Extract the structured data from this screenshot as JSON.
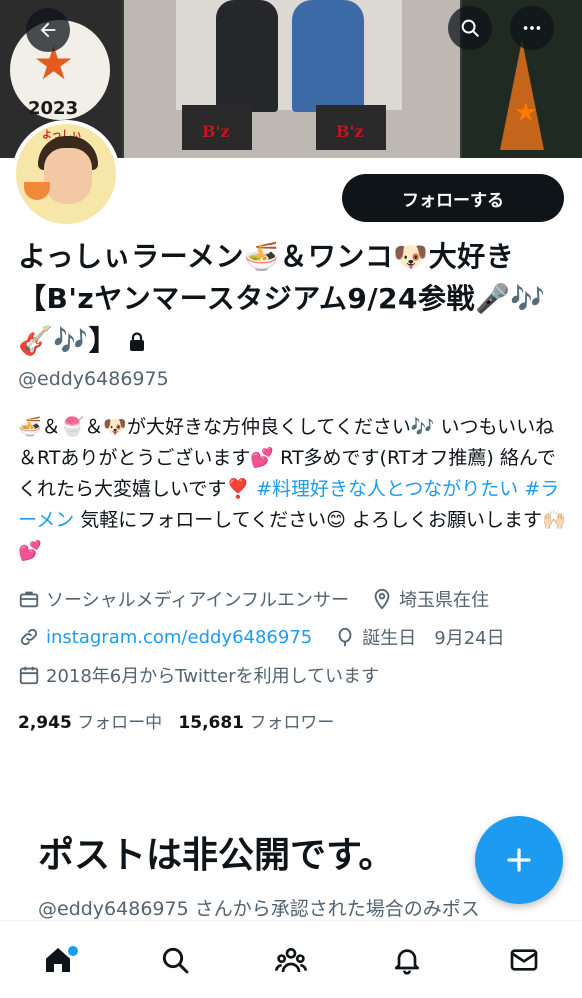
{
  "header": {
    "back_icon": "arrow-left-icon",
    "search_icon": "search-icon",
    "more_icon": "more-icon",
    "banner_year": "2023",
    "banner_bz_text": "B'z",
    "avatar_text": "よっしぃ"
  },
  "profile": {
    "follow_label": "フォローする",
    "display_name": "よっしぃラーメン🍜＆ワンコ🐶大好き【B'zヤンマースタジアム9/24参戦🎤🎶🎸🎶】",
    "handle": "@eddy6486975",
    "bio_text": "🍜＆🍧＆🐶が大好きな方仲良くしてください🎶 いつもいいね＆RTありがとうございます💕 RT多めです(RTオフ推薦) 絡んでくれたら大変嬉しいです❣️ ",
    "bio_tag1": "#料理好きな人とつながりたい",
    "bio_tag2": "#ラーメン",
    "bio_tail": " 気軽にフォローしてください😊 よろしくお願いします🙌🏻💕",
    "category": "ソーシャルメディアインフルエンサー",
    "location": "埼玉県在住",
    "website": "instagram.com/eddy6486975",
    "birthday": "誕生日　9月24日",
    "joined": "2018年6月からTwitterを利用しています",
    "following_count": "2,945",
    "following_label": "フォロー中",
    "followers_count": "15,681",
    "followers_label": "フォロワー"
  },
  "private_notice": {
    "title": "ポストは非公開です。",
    "subtitle": "@eddy6486975 さんから承認された場合のみポス"
  },
  "bottom_nav": {
    "items": [
      "home-icon",
      "search-icon",
      "communities-icon",
      "notifications-icon",
      "messages-icon"
    ]
  },
  "colors": {
    "accent": "#1d9bf0",
    "text": "#0f1419",
    "secondary": "#536471"
  }
}
